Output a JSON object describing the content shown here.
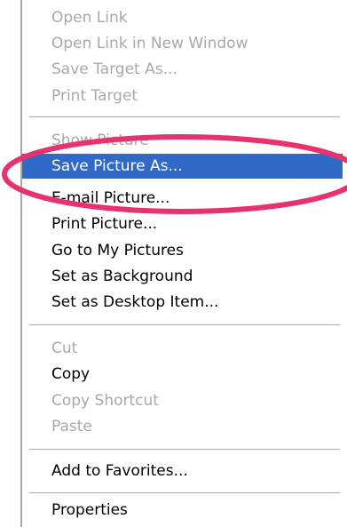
{
  "menu": {
    "group1": [
      {
        "label": "Open Link",
        "enabled": false
      },
      {
        "label": "Open Link in New Window",
        "enabled": false
      },
      {
        "label": "Save Target As...",
        "enabled": false
      },
      {
        "label": "Print Target",
        "enabled": false
      }
    ],
    "group2": [
      {
        "label": "Show Picture",
        "enabled": false
      },
      {
        "label": "Save Picture As...",
        "enabled": true,
        "selected": true
      },
      {
        "label": "E-mail Picture...",
        "enabled": true
      },
      {
        "label": "Print Picture...",
        "enabled": true
      },
      {
        "label": "Go to My Pictures",
        "enabled": true
      },
      {
        "label": "Set as Background",
        "enabled": true
      },
      {
        "label": "Set as Desktop Item...",
        "enabled": true
      }
    ],
    "group3": [
      {
        "label": "Cut",
        "enabled": false
      },
      {
        "label": "Copy",
        "enabled": true
      },
      {
        "label": "Copy Shortcut",
        "enabled": false
      },
      {
        "label": "Paste",
        "enabled": false
      }
    ],
    "group4": [
      {
        "label": "Add to Favorites...",
        "enabled": true
      }
    ],
    "group5": [
      {
        "label": "Properties",
        "enabled": true
      }
    ]
  },
  "colors": {
    "selection": "#3169c6",
    "disabled_text": "#a8a8a8",
    "annotation_ellipse": "#e8326e"
  }
}
